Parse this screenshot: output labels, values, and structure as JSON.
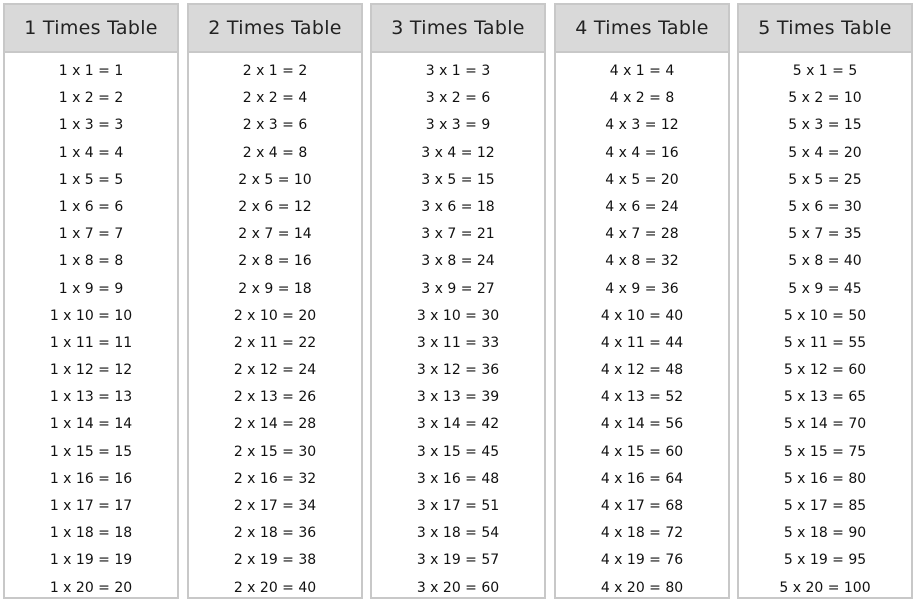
{
  "tables": [
    {
      "title": "1 Times Table",
      "rows": [
        "1 x 1 = 1",
        "1 x 2 = 2",
        "1 x 3 = 3",
        "1 x 4 = 4",
        "1 x 5 = 5",
        "1 x 6 = 6",
        "1 x 7 = 7",
        "1 x 8 = 8",
        "1 x 9 = 9",
        "1 x 10 = 10",
        "1 x 11 = 11",
        "1 x 12 = 12",
        "1 x 13 = 13",
        "1 x 14 = 14",
        "1 x 15 = 15",
        "1 x 16 = 16",
        "1 x 17 = 17",
        "1 x 18 = 18",
        "1 x 19 = 19",
        "1 x 20 = 20"
      ]
    },
    {
      "title": "2 Times Table",
      "rows": [
        "2 x 1 = 2",
        "2 x 2 = 4",
        "2 x 3 = 6",
        "2 x 4 = 8",
        "2 x 5 = 10",
        "2 x 6 = 12",
        "2 x 7 = 14",
        "2 x 8 = 16",
        "2 x 9 = 18",
        "2 x 10 = 20",
        "2 x 11 = 22",
        "2 x 12 = 24",
        "2 x 13 = 26",
        "2 x 14 = 28",
        "2 x 15 = 30",
        "2 x 16 = 32",
        "2 x 17 = 34",
        "2 x 18 = 36",
        "2 x 19 = 38",
        "2 x 20 = 40"
      ]
    },
    {
      "title": "3 Times Table",
      "rows": [
        "3 x 1 = 3",
        "3 x 2 = 6",
        "3 x 3 = 9",
        "3 x 4 = 12",
        "3 x 5 = 15",
        "3 x 6 = 18",
        "3 x 7 = 21",
        "3 x 8 = 24",
        "3 x 9 = 27",
        "3 x 10 = 30",
        "3 x 11 = 33",
        "3 x 12 = 36",
        "3 x 13 = 39",
        "3 x 14 = 42",
        "3 x 15 = 45",
        "3 x 16 = 48",
        "3 x 17 = 51",
        "3 x 18 = 54",
        "3 x 19 = 57",
        "3 x 20 = 60"
      ]
    },
    {
      "title": "4 Times Table",
      "rows": [
        "4 x 1 = 4",
        "4 x 2 = 8",
        "4 x 3 = 12",
        "4 x 4 = 16",
        "4 x 5 = 20",
        "4 x 6 = 24",
        "4 x 7 = 28",
        "4 x 8 = 32",
        "4 x 9 = 36",
        "4 x 10 = 40",
        "4 x 11 = 44",
        "4 x 12 = 48",
        "4 x 13 = 52",
        "4 x 14 = 56",
        "4 x 15 = 60",
        "4 x 16 = 64",
        "4 x 17 = 68",
        "4 x 18 = 72",
        "4 x 19 = 76",
        "4 x 20 = 80"
      ]
    },
    {
      "title": "5 Times Table",
      "rows": [
        "5 x 1 = 5",
        "5 x 2 = 10",
        "5 x 3 = 15",
        "5 x 4 = 20",
        "5 x 5 = 25",
        "5 x 6 = 30",
        "5 x 7 = 35",
        "5 x 8 = 40",
        "5 x 9 = 45",
        "5 x 10 = 50",
        "5 x 11 = 55",
        "5 x 12 = 60",
        "5 x 13 = 65",
        "5 x 14 = 70",
        "5 x 15 = 75",
        "5 x 16 = 80",
        "5 x 17 = 85",
        "5 x 18 = 90",
        "5 x 19 = 95",
        "5 x 20 = 100"
      ]
    }
  ],
  "colors": {
    "header_bg": "#d9d9d9",
    "border": "#c8c8c8"
  }
}
